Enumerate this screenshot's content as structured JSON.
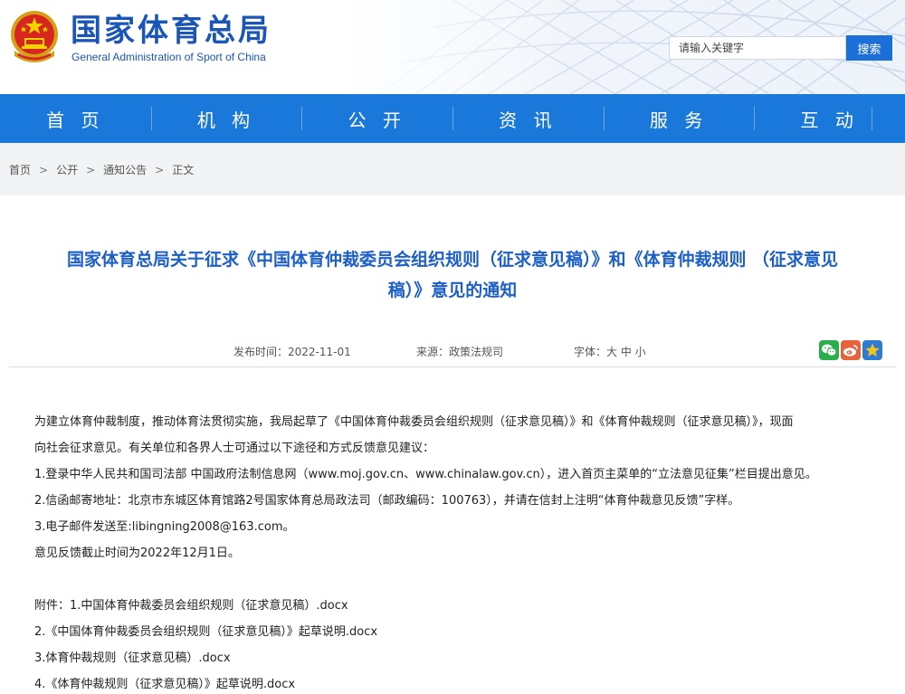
{
  "header": {
    "site_name": "国家体育总局",
    "site_name_en": "General Administration of Sport of China",
    "search_placeholder": "请输入关键字",
    "search_button": "搜索"
  },
  "nav": {
    "items": [
      "首 页",
      "机 构",
      "公 开",
      "资 讯",
      "服 务",
      "互 动"
    ]
  },
  "breadcrumb": [
    "首页",
    "公开",
    "通知公告",
    "正文"
  ],
  "breadcrumb_sep": ">",
  "article": {
    "title_line1": "国家体育总局关于征求《中国体育仲裁委员会组织规则（征求意见稿）》和《体育仲裁规则 （征求意见",
    "title_line2": "稿）》意见的通知",
    "publish_time": "发布时间：2022-11-01",
    "source": "来源：政策法规司",
    "font_size_label": "字体：大 中 小",
    "share_icons": [
      "wechat-icon",
      "weibo-icon",
      "favorite-icon"
    ],
    "paragraph1_line1": "为建立体育仲裁制度，推动体育法贯彻实施，我局起草了《中国体育仲裁委员会组织规则（征求意见稿）》和《体育仲裁规则（征求意见稿）》，现面",
    "paragraph1_line2": "向社会征求意见。有关单位和各界人士可通过以下途径和方式反馈意见建议：",
    "item1": "1.登录中华人民共和国司法部 中国政府法制信息网（www.moj.gov.cn、www.chinalaw.gov.cn），进入首页主菜单的“立法意见征集”栏目提出意见。",
    "item2": "2.信函邮寄地址：北京市东城区体育馆路2号国家体育总局政法司（邮政编码：100763），并请在信封上注明“体育仲裁意见反馈”字样。",
    "item3": "3.电子邮件发送至:libingning2008@163.com。",
    "deadline": "意见反馈截止时间为2022年12月1日。",
    "attachment1": "附件：1.中国体育仲裁委员会组织规则（征求意见稿）.docx",
    "attachment2": "2.《中国体育仲裁委员会组织规则（征求意见稿）》起草说明.docx",
    "attachment3": "3.体育仲裁规则（征求意见稿）.docx",
    "attachment4": "4.《体育仲裁规则（征求意见稿）》起草说明.docx"
  },
  "colors": {
    "brand_blue": "#1a56b8",
    "nav_blue": "#1b78db",
    "title_blue": "#1d5fc9",
    "search_button": "#1d6fd8",
    "wechat_green": "#2aae4a",
    "weibo_orange": "#e8633b",
    "favorite_blue": "#2e7bd6"
  }
}
